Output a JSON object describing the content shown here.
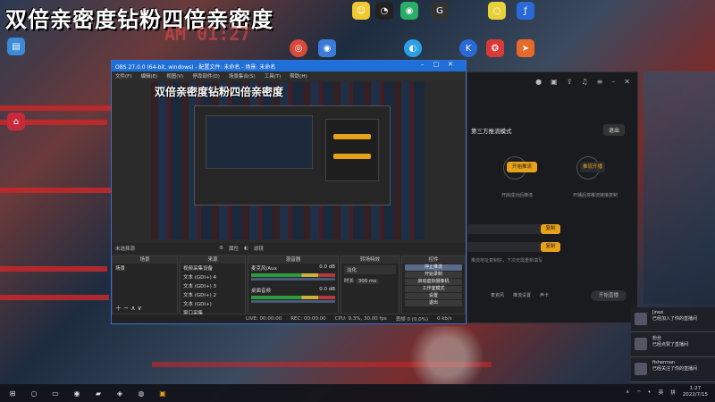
{
  "banner": {
    "text": "双倍亲密度钻粉四倍亲密度"
  },
  "overlay_time": "AM 01:27",
  "obs": {
    "title": "OBS 27.0.0 (64-bit, windows) - 配置文件: 未命名 - 场景: 未命名",
    "menu": [
      "文件(F)",
      "编辑(E)",
      "视图(V)",
      "停靠部件(D)",
      "场景集合(S)",
      "工具(T)",
      "帮助(H)"
    ],
    "preview_title": "双倍亲密度钻粉四倍亲密度",
    "source_bar": {
      "no_source": "未选择源",
      "properties": "属性",
      "filters": "滤镜"
    },
    "docks": {
      "scenes": {
        "header": "场景",
        "items": [
          "场景"
        ]
      },
      "sources": {
        "header": "来源",
        "items": [
          "视频采集设备",
          "文本 (GDI+) 4",
          "文本 (GDI+) 3",
          "文本 (GDI+) 2",
          "文本 (GDI+)",
          "窗口采集"
        ]
      },
      "mixer": {
        "header": "混音器",
        "tracks": [
          {
            "name": "麦克风/Aux",
            "db": "0.0 dB"
          },
          {
            "name": "桌面音频",
            "db": "0.0 dB"
          }
        ]
      },
      "transitions": {
        "header": "转场特效",
        "type": "淡化",
        "duration_label": "时长",
        "duration": "300 ms"
      },
      "controls": {
        "header": "控件",
        "buttons": [
          "停止推流",
          "开始录制",
          "启动虚拟摄像机",
          "工作室模式",
          "设置",
          "退出"
        ]
      }
    },
    "status": {
      "live": "LIVE: 00:00:00",
      "rec": "REC: 00:00:00",
      "cpu": "CPU: 9.3%, 30.00 fps",
      "dropped": "丢帧 0 (0.0%)",
      "kbps": "0 kb/s"
    }
  },
  "app": {
    "heading": "第三方推流模式",
    "side_button": "退出",
    "step_button": "开始推流",
    "step_button2": "推流开播",
    "captions": [
      "第三方推流软件内容",
      "开启成功后推流",
      "开播后将推流链接复制"
    ],
    "copy_label": "复制",
    "note": "推流地址复制好，下次无需重新填写",
    "bottom_items": [
      "麦克风",
      "推流设置",
      "声卡",
      "开始直播"
    ]
  },
  "notifications": [
    {
      "name": "Jinee",
      "text": "已经加入了你的直播间"
    },
    {
      "name": "粉丝",
      "text": "已经点赞了直播间"
    },
    {
      "name": "fisherman",
      "text": "已经关注了你的直播间"
    }
  ],
  "taskbar": {
    "ime": "英",
    "lang": "拼",
    "time": "1:27",
    "date": "2022/7/15"
  }
}
